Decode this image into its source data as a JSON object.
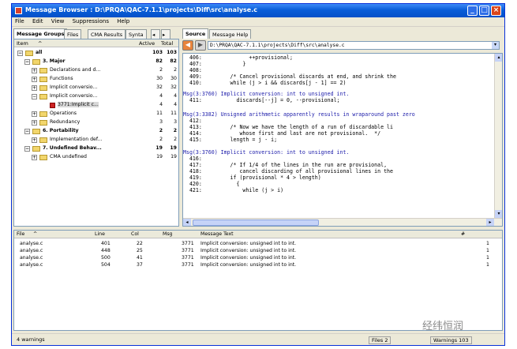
{
  "window": {
    "title": "Message Browser : D:\\PRQA\\QAC-7.1.1\\projects\\Diff\\src\\analyse.c"
  },
  "menu": [
    "File",
    "Edit",
    "View",
    "Suppressions",
    "Help"
  ],
  "left_tabs": [
    "Message Groups",
    "Files",
    "CMA Results",
    "Synta"
  ],
  "tree": {
    "headers": {
      "item": "Item",
      "active": "Active",
      "total": "Total"
    },
    "rows": [
      {
        "label": "all",
        "active": "103",
        "total": "103"
      },
      {
        "label": "3. Major",
        "active": "82",
        "total": "82"
      },
      {
        "label": "Declarations and d...",
        "active": "2",
        "total": "2"
      },
      {
        "label": "Functions",
        "active": "30",
        "total": "30"
      },
      {
        "label": "Implicit conversio...",
        "active": "32",
        "total": "32"
      },
      {
        "label": "Implicit conversio...",
        "active": "4",
        "total": "4"
      },
      {
        "label": "3771:Implicit c...",
        "active": "4",
        "total": "4"
      },
      {
        "label": "Operations",
        "active": "11",
        "total": "11"
      },
      {
        "label": "Redundancy",
        "active": "3",
        "total": "3"
      },
      {
        "label": "6. Portability",
        "active": "2",
        "total": "2"
      },
      {
        "label": "Implementation def...",
        "active": "2",
        "total": "2"
      },
      {
        "label": "7. Undefined Behav...",
        "active": "19",
        "total": "19"
      },
      {
        "label": "CMA undefined",
        "active": "19",
        "total": "19"
      }
    ]
  },
  "right_tabs": [
    "Source",
    "Message Help"
  ],
  "source": {
    "path": "D:\\PRQA\\QAC-7.1.1\\projects\\Diff\\src\\analyse.c",
    "lines": [
      {
        "text": "  406:               ++provisional;"
      },
      {
        "text": "  407:             }"
      },
      {
        "text": "  408:"
      },
      {
        "text": "  409:         /* Cancel provisional discards at end, and shrink the"
      },
      {
        "text": "  410:         while (j > i && discards[j - 1] == 2)"
      },
      {
        "text": "Msg(3:3760) Implicit conversion: int to unsigned int.",
        "msg": true
      },
      {
        "text": "  411:           discards[--j] = 0, --provisional;"
      },
      {
        "text": ""
      },
      {
        "text": "Msg(3:3382) Unsigned arithmetic apparently results in wraparound past zero",
        "msg": true
      },
      {
        "text": "  412:"
      },
      {
        "text": "  413:         /* Now we have the length of a run of discardable li"
      },
      {
        "text": "  414:            whose first and last are not provisional.  */"
      },
      {
        "text": "  415:         length = j - i;"
      },
      {
        "text": ""
      },
      {
        "text": "Msg(3:3760) Implicit conversion: int to unsigned int.",
        "msg": true
      },
      {
        "text": "  416:"
      },
      {
        "text": "  417:         /* If 1/4 of the lines in the run are provisional,"
      },
      {
        "text": "  418:            cancel discarding of all provisional lines in the"
      },
      {
        "text": "  419:         if (provisional * 4 > length)"
      },
      {
        "text": "  420:           {"
      },
      {
        "text": "  421:             while (j > i)"
      }
    ]
  },
  "message_list": {
    "headers": {
      "file": "File",
      "line": "Line",
      "col": "Col",
      "msg": "Msg",
      "text": "Message Text",
      "num": "#"
    },
    "rows": [
      {
        "file": "analyse.c",
        "line": "401",
        "col": "22",
        "msg": "3771",
        "text": "Implicit conversion: unsigned int to int.",
        "num": "1"
      },
      {
        "file": "analyse.c",
        "line": "448",
        "col": "25",
        "msg": "3771",
        "text": "Implicit conversion: unsigned int to int.",
        "num": "1"
      },
      {
        "file": "analyse.c",
        "line": "500",
        "col": "41",
        "msg": "3771",
        "text": "Implicit conversion: unsigned int to int.",
        "num": "1"
      },
      {
        "file": "analyse.c",
        "line": "504",
        "col": "37",
        "msg": "3771",
        "text": "Implicit conversion: unsigned int to int.",
        "num": "1"
      }
    ]
  },
  "status": {
    "left": "4 warnings",
    "files": "Files 2",
    "warnings": "Warnings 103"
  },
  "watermark": "经纬恒润"
}
